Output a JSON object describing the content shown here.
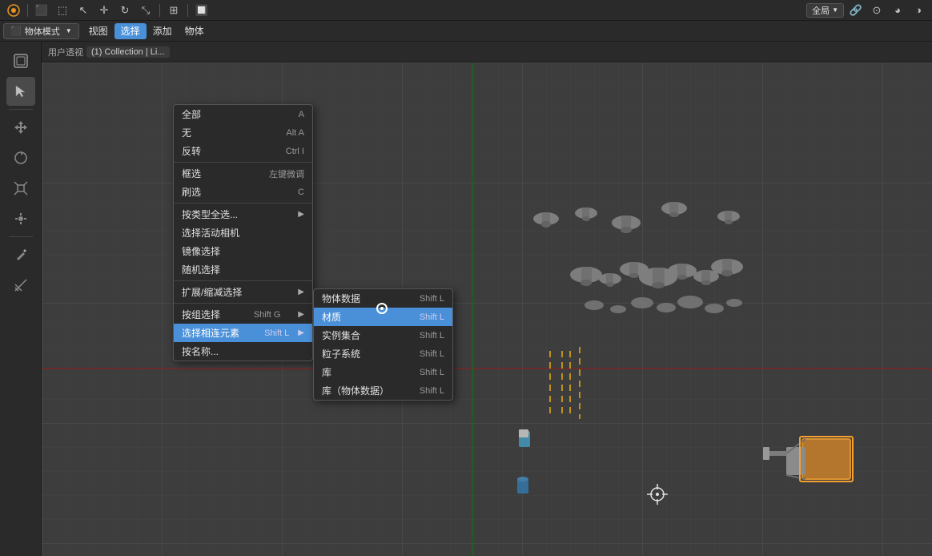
{
  "topbar": {
    "title": "Blender",
    "mode_label": "物体模式",
    "view_label": "视图",
    "select_label": "选择",
    "add_label": "添加",
    "object_label": "物体",
    "global_label": "全局",
    "breadcrumb": "用户透视",
    "collection": "(1) Collection | Li..."
  },
  "select_menu": {
    "items": [
      {
        "label": "全部",
        "shortcut": "A",
        "has_sub": false
      },
      {
        "label": "无",
        "shortcut": "Alt A",
        "has_sub": false
      },
      {
        "label": "反转",
        "shortcut": "Ctrl I",
        "has_sub": false
      },
      {
        "label": "框选",
        "shortcut": "左键微调",
        "has_sub": false
      },
      {
        "label": "刷选",
        "shortcut": "C",
        "has_sub": false
      },
      {
        "label": "按类型全选...",
        "shortcut": "",
        "has_sub": true
      },
      {
        "label": "选择活动相机",
        "shortcut": "",
        "has_sub": false
      },
      {
        "label": "镜像选择",
        "shortcut": "",
        "has_sub": false
      },
      {
        "label": "随机选择",
        "shortcut": "",
        "has_sub": false
      },
      {
        "label": "扩展/缩减选择",
        "shortcut": "",
        "has_sub": true
      },
      {
        "label": "按组选择",
        "shortcut": "Shift G",
        "has_sub": true
      },
      {
        "label": "选择相连元素",
        "shortcut": "Shift L",
        "has_sub": true,
        "active": true
      },
      {
        "label": "按名称...",
        "shortcut": "",
        "has_sub": false
      }
    ]
  },
  "linked_menu": {
    "items": [
      {
        "label": "物体数据",
        "shortcut": "Shift L",
        "highlighted": false
      },
      {
        "label": "材质",
        "shortcut": "Shift L",
        "highlighted": true
      },
      {
        "label": "实例集合",
        "shortcut": "Shift L",
        "highlighted": false
      },
      {
        "label": "粒子系统",
        "shortcut": "Shift L",
        "highlighted": false
      },
      {
        "label": "库",
        "shortcut": "Shift L",
        "highlighted": false
      },
      {
        "label": "库（物体数据）",
        "shortcut": "Shift L",
        "highlighted": false
      }
    ]
  },
  "viewport": {
    "view_name": "用户透视",
    "collection_path": "(1) Collection | Li..."
  },
  "colors": {
    "bg": "#3d3d3d",
    "menu_bg": "#2a2a2a",
    "active_blue": "#4a90d9",
    "highlight_blue": "#4a90d9",
    "grid": "#444444",
    "axis_red": "#cc4444",
    "axis_green": "#44aa44"
  }
}
